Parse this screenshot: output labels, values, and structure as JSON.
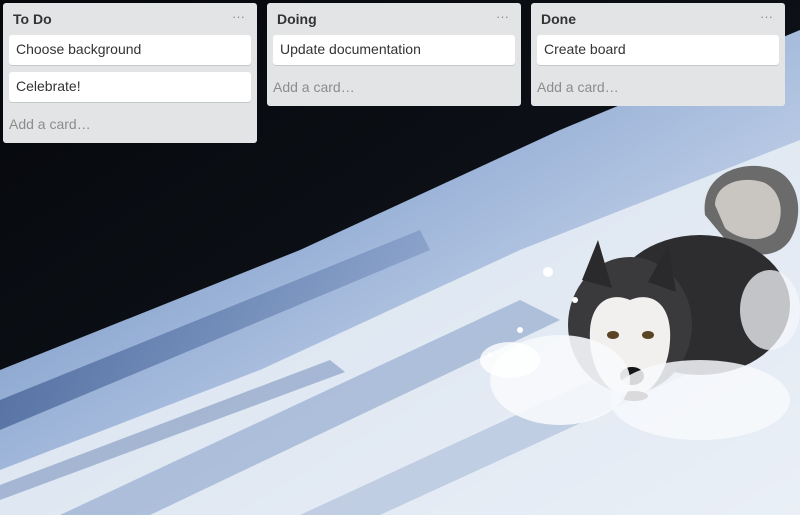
{
  "lists": [
    {
      "title": "To Do",
      "menu": "···",
      "cards": [
        "Choose background",
        "Celebrate!"
      ],
      "add_card": "Add a card…"
    },
    {
      "title": "Doing",
      "menu": "···",
      "cards": [
        "Update documentation"
      ],
      "add_card": "Add a card…"
    },
    {
      "title": "Done",
      "menu": "···",
      "cards": [
        "Create board"
      ],
      "add_card": "Add a card…"
    }
  ],
  "colors": {
    "list_background": "#e2e4e6",
    "card_background": "#ffffff",
    "title_text": "#333333",
    "muted_text": "#8c8c8c"
  },
  "icons": {
    "list_menu": "ellipsis-icon"
  }
}
